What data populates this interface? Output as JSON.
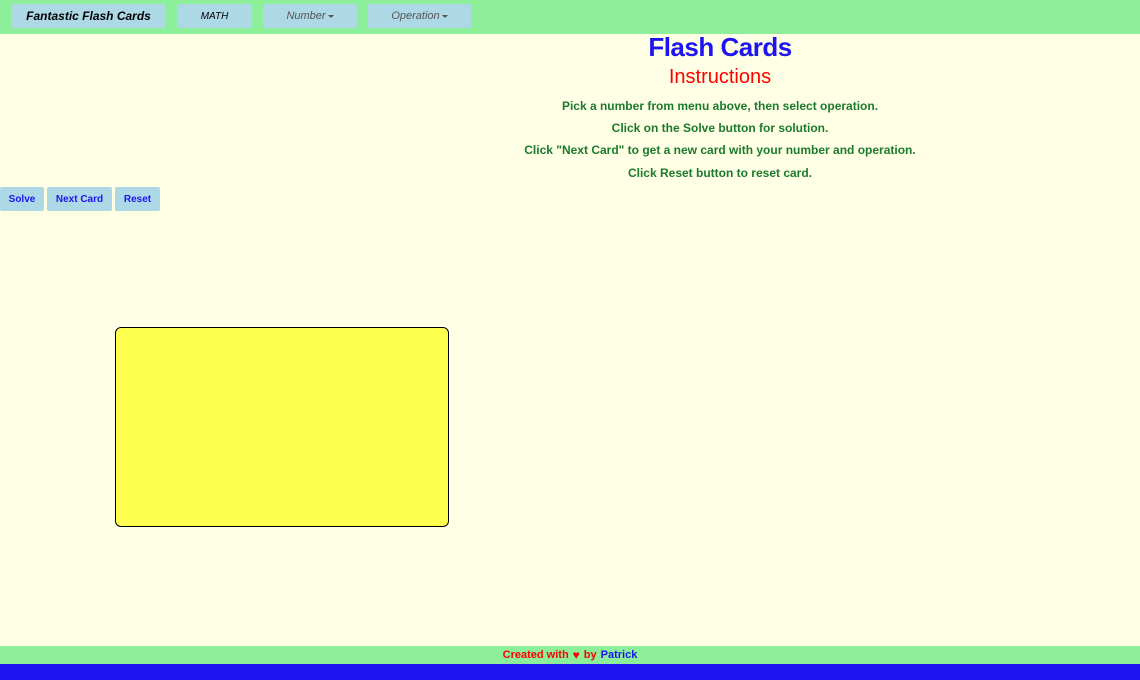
{
  "navbar": {
    "brand": "Fantastic Flash Cards",
    "math": "MATH",
    "number": "Number",
    "operation": "Operation"
  },
  "main": {
    "title": "Flash Cards",
    "subtitle": "Instructions",
    "instructions": [
      "Pick a number from menu above, then select operation.",
      "Click on the Solve button for solution.",
      "Click \"Next Card\" to get a new card with your number and operation.",
      "Click Reset button to reset card."
    ]
  },
  "buttons": {
    "solve": "Solve",
    "next": "Next Card",
    "reset": "Reset"
  },
  "footer": {
    "created": "Created with",
    "heart": "♥",
    "by": "by",
    "author": "Patrick"
  },
  "colors": {
    "nav_bg": "#8eef9a",
    "page_bg": "#ffffe6",
    "button_bg": "#add8e6",
    "title": "#1e14f0",
    "subtitle": "#ff0000",
    "instructions": "#1c7a2c",
    "card": "#ffff4f",
    "bottom_bar": "#1e14f0"
  }
}
